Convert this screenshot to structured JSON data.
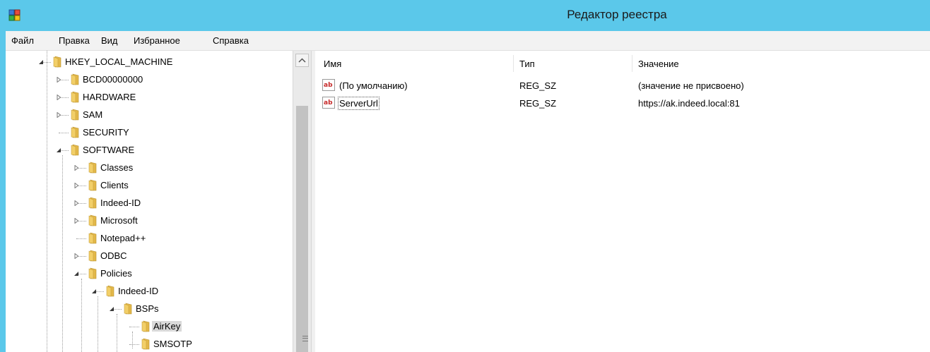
{
  "window": {
    "title": "Редактор реестра"
  },
  "menu": [
    "Файл",
    "Правка",
    "Вид",
    "Избранное",
    "Справка"
  ],
  "tree": [
    {
      "label": "HKEY_LOCAL_MACHINE",
      "level": 0,
      "expander": "expanded"
    },
    {
      "label": "BCD00000000",
      "level": 1,
      "expander": "collapsed"
    },
    {
      "label": "HARDWARE",
      "level": 1,
      "expander": "collapsed"
    },
    {
      "label": "SAM",
      "level": 1,
      "expander": "collapsed"
    },
    {
      "label": "SECURITY",
      "level": 1,
      "expander": "none"
    },
    {
      "label": "SOFTWARE",
      "level": 1,
      "expander": "expanded"
    },
    {
      "label": "Classes",
      "level": 2,
      "expander": "collapsed"
    },
    {
      "label": "Clients",
      "level": 2,
      "expander": "collapsed"
    },
    {
      "label": "Indeed-ID",
      "level": 2,
      "expander": "collapsed"
    },
    {
      "label": "Microsoft",
      "level": 2,
      "expander": "collapsed"
    },
    {
      "label": "Notepad++",
      "level": 2,
      "expander": "none"
    },
    {
      "label": "ODBC",
      "level": 2,
      "expander": "collapsed"
    },
    {
      "label": "Policies",
      "level": 2,
      "expander": "expanded"
    },
    {
      "label": "Indeed-ID",
      "level": 3,
      "expander": "expanded"
    },
    {
      "label": "BSPs",
      "level": 4,
      "expander": "expanded"
    },
    {
      "label": "AirKey",
      "level": 5,
      "expander": "none",
      "selected": true
    },
    {
      "label": "SMSOTP",
      "level": 5,
      "expander": "none"
    }
  ],
  "columns": {
    "name": "Имя",
    "type": "Тип",
    "value": "Значение"
  },
  "values": [
    {
      "name": "(По умолчанию)",
      "type": "REG_SZ",
      "data": "(значение не присвоено)",
      "icon": "string-value-icon"
    },
    {
      "name": "ServerUrl",
      "type": "REG_SZ",
      "data": "https://ak.indeed.local:81",
      "icon": "string-value-icon",
      "focused": true
    }
  ],
  "icons": {
    "app": "registry-editor-icon",
    "folder": "folder-icon",
    "value": "string-value-icon"
  },
  "colors": {
    "titlebar": "#5bc8ea",
    "folder": "#f2cf68",
    "ab_red": "#c62828",
    "selection": "#d9d9d9"
  }
}
